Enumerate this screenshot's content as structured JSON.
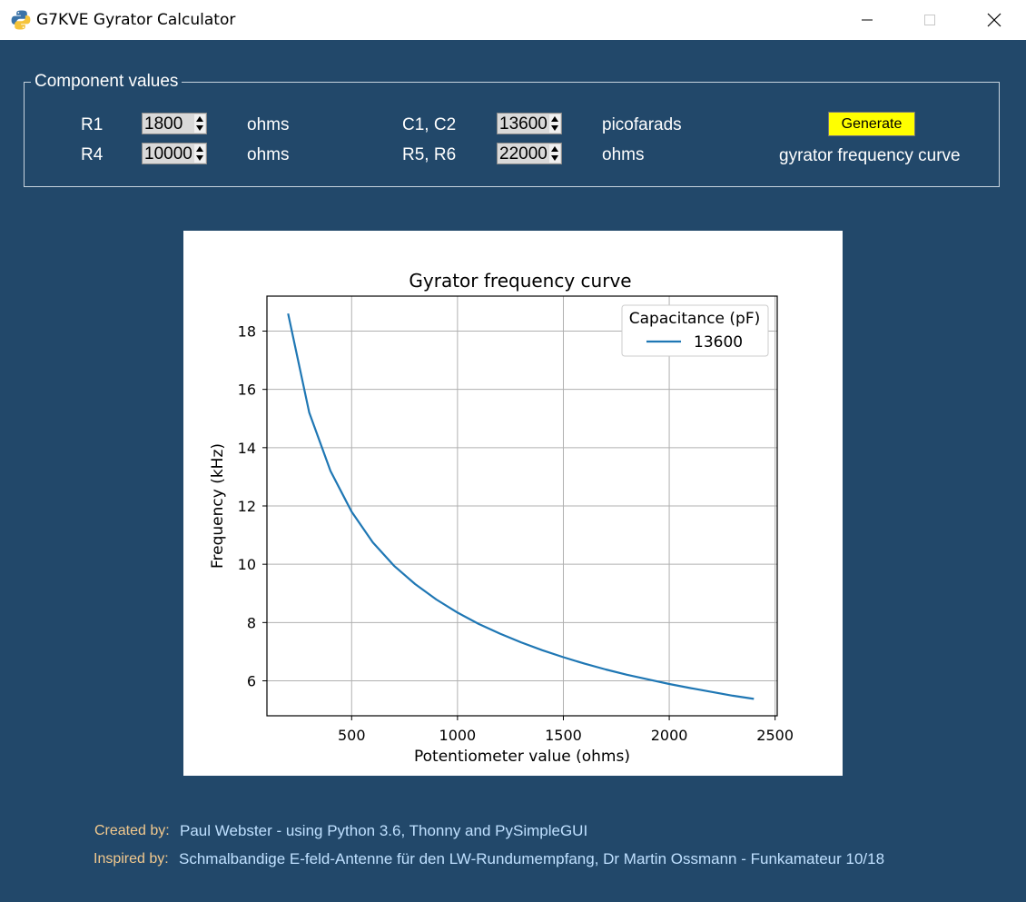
{
  "window": {
    "title": "G7KVE Gyrator Calculator",
    "icon": "python-icon"
  },
  "frame": {
    "title": "Component values"
  },
  "fields": [
    {
      "label": "R1",
      "value": "1800",
      "unit": "ohms"
    },
    {
      "label": "R4",
      "value": "10000",
      "unit": "ohms"
    },
    {
      "label": "C1, C2",
      "value": "13600",
      "unit": "picofarads"
    },
    {
      "label": "R5, R6",
      "value": "22000",
      "unit": "ohms"
    }
  ],
  "generate": {
    "button_label": "Generate",
    "caption": "gyrator frequency curve",
    "color": "#ffff00"
  },
  "chart_data": {
    "type": "line",
    "title": "Gyrator frequency curve",
    "xlabel": "Potentiometer value (ohms)",
    "ylabel": "Frequency (kHz)",
    "xlim": [
      100,
      2510
    ],
    "ylim": [
      4.8,
      19.2
    ],
    "xticks": [
      500,
      1000,
      1500,
      2000,
      2500
    ],
    "yticks": [
      6,
      8,
      10,
      12,
      14,
      16,
      18
    ],
    "grid": true,
    "legend": {
      "title": "Capacitance (pF)",
      "position": "top-right"
    },
    "series": [
      {
        "name": "13600",
        "color": "#1f77b4",
        "x": [
          200,
          300,
          400,
          500,
          600,
          700,
          800,
          900,
          1000,
          1100,
          1200,
          1300,
          1400,
          1500,
          1600,
          1700,
          1800,
          1900,
          2000,
          2100,
          2200,
          2300,
          2400
        ],
        "y": [
          18.6,
          15.2,
          13.2,
          11.8,
          10.75,
          9.95,
          9.32,
          8.79,
          8.34,
          7.95,
          7.62,
          7.32,
          7.05,
          6.81,
          6.59,
          6.39,
          6.21,
          6.05,
          5.89,
          5.75,
          5.62,
          5.49,
          5.38
        ]
      }
    ]
  },
  "footer": [
    {
      "label": "Created by:",
      "value": "Paul Webster - using Python 3.6, Thonny and PySimpleGUI"
    },
    {
      "label": "Inspired by:",
      "value": "Schmalbandige E-feld-Antenne für den LW-Rundumempfang, Dr Martin Ossmann - Funkamateur 10/18"
    }
  ]
}
